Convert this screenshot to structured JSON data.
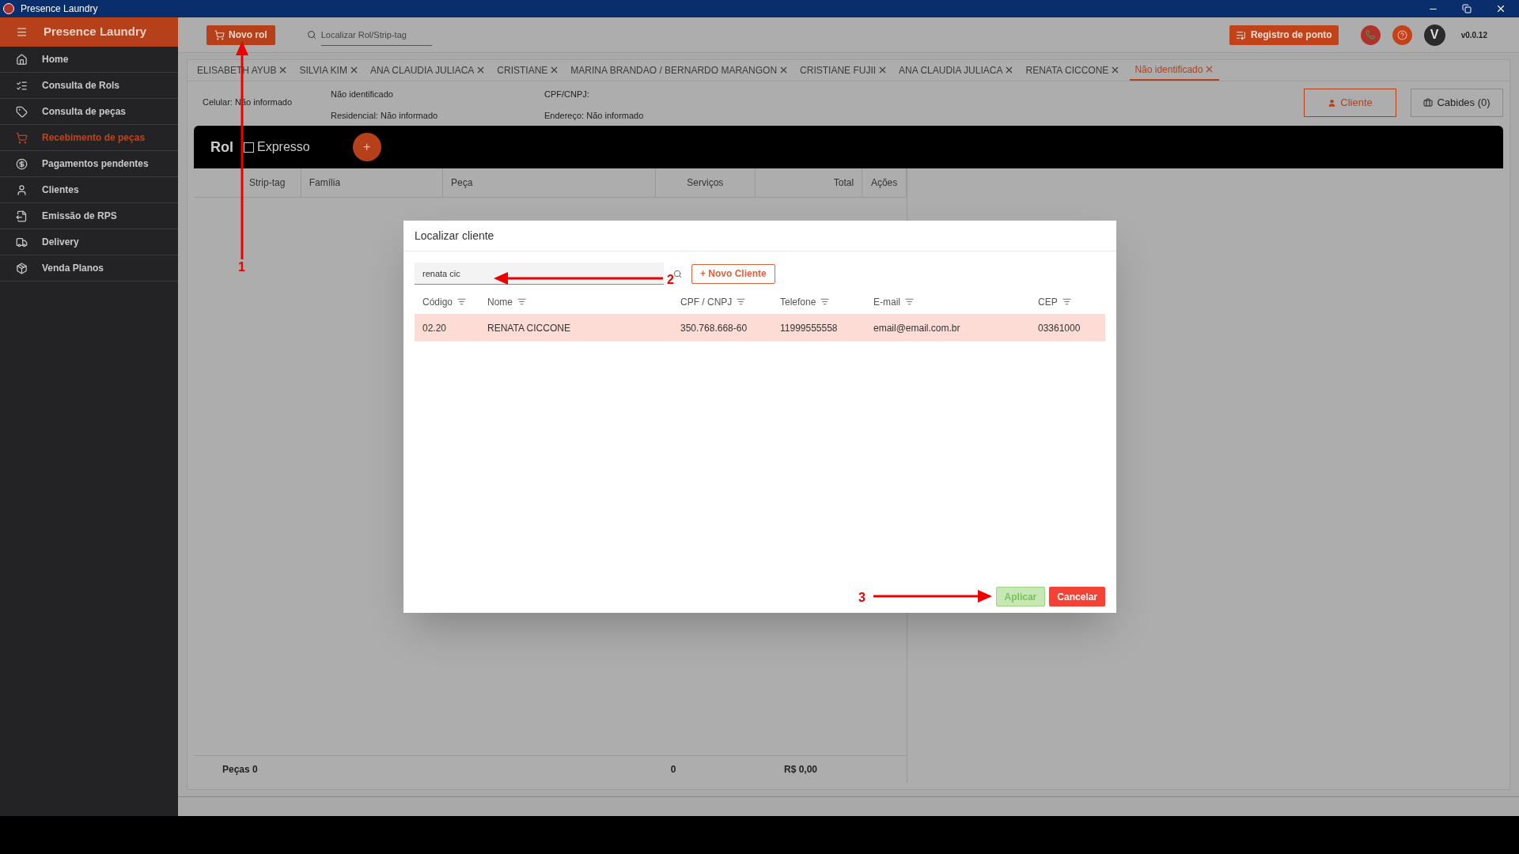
{
  "window": {
    "title": "Presence Laundry"
  },
  "sidebar": {
    "title": "Presence Laundry",
    "items": [
      {
        "label": "Home",
        "selected": false
      },
      {
        "label": "Consulta de Rols",
        "selected": false
      },
      {
        "label": "Consulta de peças",
        "selected": false
      },
      {
        "label": "Recebimento de peças",
        "selected": true
      },
      {
        "label": "Pagamentos pendentes",
        "selected": false
      },
      {
        "label": "Clientes",
        "selected": false
      },
      {
        "label": "Emissão de RPS",
        "selected": false
      },
      {
        "label": "Delivery",
        "selected": false
      },
      {
        "label": "Venda Planos",
        "selected": false
      }
    ]
  },
  "toolbar": {
    "new_button": "Novo rol",
    "search": {
      "placeholder": "Localizar Rol/Strip-tag"
    },
    "clock_button": "Registro de ponto",
    "avatar": "V",
    "version": "v0.0.12"
  },
  "tabs": [
    {
      "label": "ELISABETH AYUB",
      "selected": false
    },
    {
      "label": "SILVIA KIM",
      "selected": false
    },
    {
      "label": "ANA CLAUDIA JULIACA",
      "selected": false
    },
    {
      "label": "CRISTIANE",
      "selected": false
    },
    {
      "label": "MARINA BRANDAO / BERNARDO MARANGON",
      "selected": false
    },
    {
      "label": "CRISTIANE FUJII",
      "selected": false
    },
    {
      "label": "ANA CLAUDIA JULIACA",
      "selected": false
    },
    {
      "label": "RENATA CICCONE",
      "selected": false
    },
    {
      "label": "Não identificado",
      "selected": true
    }
  ],
  "client_info": {
    "col1": [
      "Celular: Não informado"
    ],
    "col2": [
      "Não identificado",
      "Residencial: Não informado"
    ],
    "col3": [
      "CPF/CNPJ:",
      "Endereço: Não informado"
    ],
    "client_button": "Cliente",
    "hangers_button": "Cabides (0)"
  },
  "rol": {
    "title": "Rol",
    "express": {
      "label": "Expresso",
      "checked": false
    },
    "add_button": "+",
    "columns": [
      "Strip-tag",
      "Família",
      "Peça",
      "Serviços",
      "Total",
      "Ações"
    ],
    "footer": {
      "pieces": "Peças 0",
      "count": "0",
      "total": "R$ 0,00"
    }
  },
  "dialog": {
    "title": "Localizar cliente",
    "search": {
      "value": "renata cic"
    },
    "new_button": "+ Novo Cliente",
    "columns": [
      "Código",
      "Nome",
      "CPF / CNPJ",
      "Telefone",
      "E-mail",
      "CEP"
    ],
    "rows": [
      {
        "cells": [
          "02.20",
          "RENATA CICCONE",
          "350.768.668-60",
          "11999555558",
          "email@email.com.br",
          "03361000"
        ],
        "selected": true
      }
    ],
    "apply_button": "Aplicar",
    "cancel_button": "Cancelar"
  },
  "annotations": [
    "1",
    "2",
    "3"
  ]
}
